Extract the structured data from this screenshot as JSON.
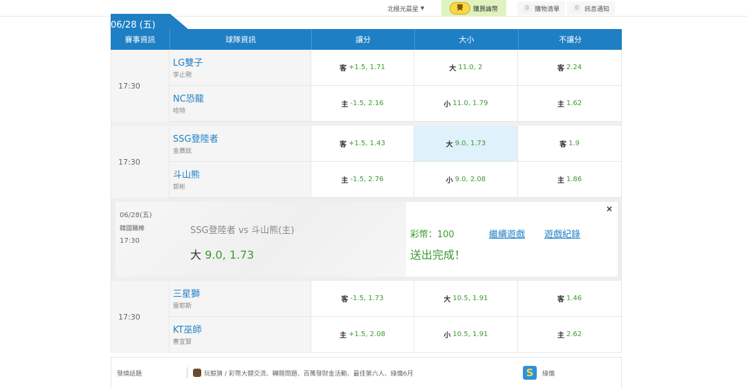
{
  "topbar": {
    "user_label": "北極光晨星",
    "buy_badge": "賽",
    "buy_label": "購買論幣",
    "cart_count": "0",
    "cart_label": "購物清單",
    "msg_count": "0",
    "msg_label": "訊息通知"
  },
  "date_tab": "06/28 (五)",
  "headers": [
    "賽事資訊",
    "球隊資訊",
    "讓分",
    "大小",
    "不讓分"
  ],
  "games": [
    {
      "time": "17:30",
      "rows": [
        {
          "team": "LG雙子",
          "pitcher": "李止剛",
          "spread_lbl": "客",
          "spread": "+1.5, 1.71",
          "ou_lbl": "大",
          "ou": "11.0, 2",
          "ml_lbl": "客",
          "ml": "2.24"
        },
        {
          "team": "NC恐龍",
          "pitcher": "哈特",
          "spread_lbl": "主",
          "spread": "-1.5, 2.16",
          "ou_lbl": "小",
          "ou": "11.0, 1.79",
          "ml_lbl": "主",
          "ml": "1.62"
        }
      ]
    },
    {
      "time": "17:30",
      "rows": [
        {
          "team": "SSG登陸者",
          "pitcher": "金廣鉉",
          "spread_lbl": "客",
          "spread": "+1.5, 1.43",
          "ou_lbl": "大",
          "ou": "9.0, 1.73",
          "ml_lbl": "客",
          "ml": "1.9"
        },
        {
          "team": "斗山熊",
          "pitcher": "郭彬",
          "spread_lbl": "主",
          "spread": "-1.5, 2.76",
          "ou_lbl": "小",
          "ou": "9.0, 2.08",
          "ml_lbl": "主",
          "ml": "1.86"
        }
      ]
    },
    {
      "time": "17:30",
      "rows": [
        {
          "team": "三星獅",
          "pitcher": "雷耶斯",
          "spread_lbl": "客",
          "spread": "-1.5, 1.73",
          "ou_lbl": "大",
          "ou": "10.5, 1.91",
          "ml_lbl": "客",
          "ml": "1.46"
        },
        {
          "team": "KT巫師",
          "pitcher": "曹宣賢",
          "spread_lbl": "主",
          "spread": "+1.5, 2.08",
          "ou_lbl": "小",
          "ou": "10.5, 1.91",
          "ml_lbl": "主",
          "ml": "2.62"
        }
      ]
    }
  ],
  "confirm": {
    "date": "06/28(五)",
    "league": "韓國職棒",
    "time": "17:30",
    "match": "SSG登陸者  vs  斗山熊(主)",
    "pick_lbl": "大",
    "pick_val": "9.0, 1.73",
    "coins": "彩幣：100",
    "done": "送出完成！",
    "continue_link": "繼續遊戲",
    "history_link": "遊戲紀錄",
    "close": "×"
  },
  "hot_topics": {
    "label": "發燒話題",
    "topics": "玩競猜 / 彩幣大額交流、轉贈問題、百萬發財金活動、最佳第六人、綠僑6月",
    "brand_logo": "S",
    "brand": "綠僑"
  },
  "colors": {
    "accent": "#1e7fc4",
    "odds_green": "#3a9a2e",
    "highlight": "#dff1fb"
  }
}
